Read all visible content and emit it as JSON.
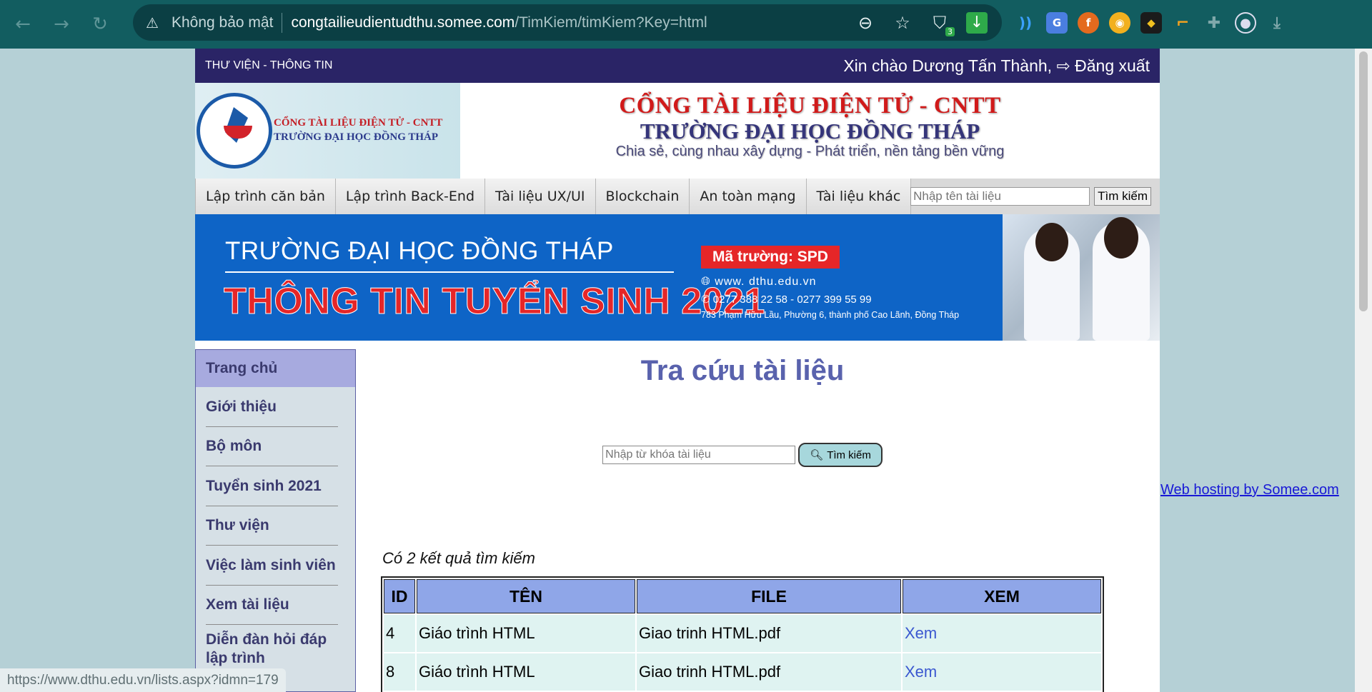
{
  "browser": {
    "security_label": "Không bảo mật",
    "url_host": "congtailieudientudthu.somee.com",
    "url_path": "/TimKiem/timKiem?Key=html",
    "shield_badge": "3"
  },
  "topbar": {
    "library_label": "THƯ VIỆN - THÔNG TIN",
    "greeting": "Xin chào Dương Tấn Thành,",
    "logout_label": "Đăng xuất"
  },
  "logo": {
    "line1": "CỔNG TÀI LIỆU ĐIỆN TỬ - CNTT",
    "line2": "TRƯỜNG ĐẠI HỌC ĐỒNG THÁP"
  },
  "site": {
    "title1": "CỔNG TÀI LIỆU ĐIỆN TỬ - CNTT",
    "title2": "TRƯỜNG ĐẠI HỌC ĐỒNG THÁP",
    "slogan": "Chia sẻ, cùng nhau xây dựng - Phát triển, nền tảng bền vững"
  },
  "menu": {
    "items": [
      "Lập trình căn bản",
      "Lập trình Back-End",
      "Tài liệu UX/UI",
      "Blockchain",
      "An toàn mạng",
      "Tài liệu khác"
    ],
    "search_placeholder": "Nhập tên tài liệu",
    "search_button": "Tìm kiếm"
  },
  "banner": {
    "school": "TRƯỜNG ĐẠI HỌC ĐỒNG THÁP",
    "headline": "THÔNG TIN TUYỂN SINH 2021",
    "school_code": "Mã trường: SPD",
    "website": "www. dthu.edu.vn",
    "phones": "0277 388 22 58  -  0277 399 55 99",
    "address": "783 Phạm Hữu Lầu, Phường 6, thành phố Cao Lãnh, Đồng Tháp"
  },
  "sidebar": {
    "items": [
      "Trang chủ",
      "Giới thiệu",
      "Bộ môn",
      "Tuyển sinh 2021",
      "Thư viện",
      "Việc làm sinh viên",
      "Xem tài liệu",
      "Diễn đàn hỏi đáp lập trình"
    ]
  },
  "main": {
    "heading": "Tra cứu tài liệu",
    "search_placeholder": "Nhập từ khóa tài liệu",
    "search_button": "Tìm kiếm",
    "results_count": "Có 2 kết quả tìm kiếm",
    "table": {
      "headers": [
        "ID",
        "TÊN",
        "FILE",
        "XEM"
      ],
      "rows": [
        {
          "id": "4",
          "name": "Giáo trình HTML",
          "file": "Giao trinh HTML.pdf",
          "view": "Xem"
        },
        {
          "id": "8",
          "name": "Giáo trình HTML",
          "file": "Giao trinh HTML.pdf",
          "view": "Xem"
        }
      ]
    }
  },
  "footer": {
    "hosting_link": "Web hosting by Somee.com"
  },
  "status": {
    "link_preview": "https://www.dthu.edu.vn/lists.aspx?idmn=179"
  },
  "colors": {
    "browser_bar": "#125d60",
    "topbar": "#2a2466",
    "heading": "#5962ad",
    "table_header": "#8fa6e8",
    "table_row": "#dff3f1",
    "sidebar_active": "#a7aadf"
  }
}
